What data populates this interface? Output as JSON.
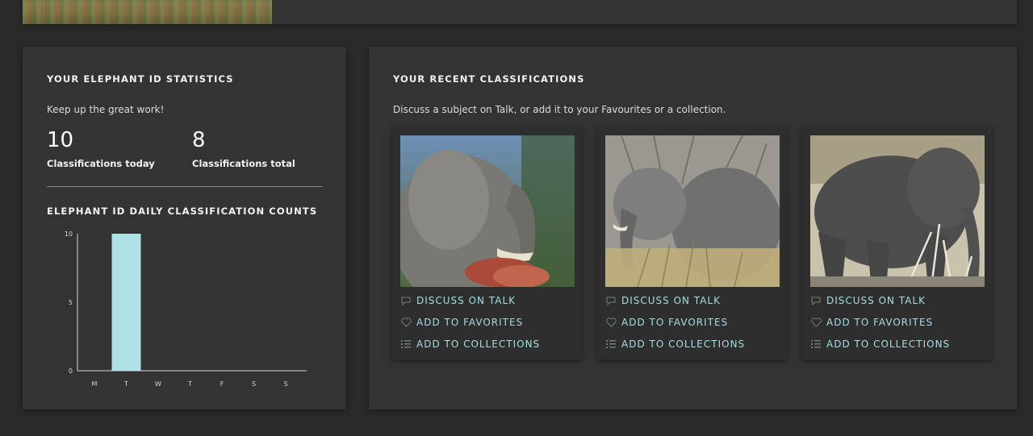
{
  "stats": {
    "heading": "YOUR ELEPHANT ID STATISTICS",
    "encouragement": "Keep up the great work!",
    "today": {
      "value": "10",
      "label": "Classifications today"
    },
    "total": {
      "value": "8",
      "label": "Classifications total"
    }
  },
  "daily": {
    "heading": "ELEPHANT ID DAILY CLASSIFICATION COUNTS"
  },
  "chart_data": {
    "type": "bar",
    "categories": [
      "M",
      "T",
      "W",
      "T",
      "F",
      "S",
      "S"
    ],
    "values": [
      0,
      10,
      0,
      0,
      0,
      0,
      0
    ],
    "ylim": [
      0,
      10
    ],
    "yticks": [
      "0",
      "5",
      "10"
    ],
    "title": "",
    "xlabel": "",
    "ylabel": "",
    "bar_color": "#afe2e6",
    "grid": false
  },
  "recent": {
    "heading": "YOUR RECENT CLASSIFICATIONS",
    "description": "Discuss a subject on Talk, or add it to your Favourites or a collection.",
    "subjects": [
      {
        "talk": "DISCUSS ON TALK",
        "favorite": "ADD TO FAVORITES",
        "collection": "ADD TO COLLECTIONS"
      },
      {
        "talk": "DISCUSS ON TALK",
        "favorite": "ADD TO FAVORITES",
        "collection": "ADD TO COLLECTIONS"
      },
      {
        "talk": "DISCUSS ON TALK",
        "favorite": "ADD TO FAVORITES",
        "collection": "ADD TO COLLECTIONS"
      }
    ]
  },
  "colors": {
    "accent": "#a6dde1",
    "card": "#333333",
    "background": "#2a2a2a"
  }
}
